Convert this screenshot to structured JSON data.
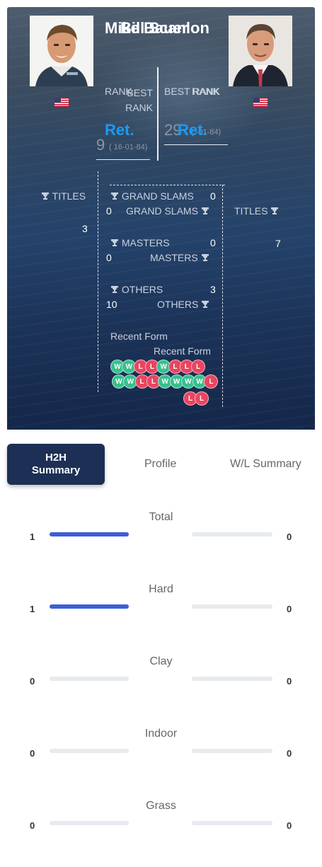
{
  "players": {
    "left": {
      "name": "Mike Bauer",
      "rank_label": "RANK",
      "rank_value": "Ret.",
      "best_rank_label": "BEST RANK",
      "best_rank_value": "9",
      "best_rank_date": "( 16-01-84)",
      "titles_label": "TITLES",
      "titles_value": "3",
      "grand_slams_label": "GRAND SLAMS",
      "grand_slams_value": "0",
      "masters_label": "MASTERS",
      "masters_value": "0",
      "others_label": "OTHERS",
      "others_value": "3",
      "recent_form_label": "Recent Form",
      "recent_form": [
        "W",
        "W",
        "L",
        "L",
        "W",
        "L",
        "L",
        "L"
      ]
    },
    "right": {
      "name": "Bill Scanlon",
      "rank_label": "RANK",
      "rank_value": "Ret.",
      "best_rank_label": "BEST RANK",
      "best_rank_value": "29",
      "best_rank_date": "( -01-84)",
      "titles_label": "TITLES",
      "titles_value": "7",
      "grand_slams_label": "GRAND SLAMS",
      "grand_slams_value": "0",
      "masters_label": "MASTERS",
      "masters_value": "0",
      "others_label": "OTHERS",
      "others_value": "10",
      "recent_form_label": "Recent Form",
      "recent_form": [
        "W",
        "W",
        "L",
        "L",
        "W",
        "W",
        "W",
        "W",
        "L",
        "L",
        "L"
      ]
    }
  },
  "tabs": {
    "h2h_line1": "H2H",
    "h2h_line2": "Summary",
    "profile": "Profile",
    "wl_summary": "W/L Summary"
  },
  "surfaces": [
    {
      "label": "Total",
      "left": "1",
      "right": "0",
      "left_fraction": 1.0,
      "right_fraction": 0.0
    },
    {
      "label": "Hard",
      "left": "1",
      "right": "0",
      "left_fraction": 1.0,
      "right_fraction": 0.0
    },
    {
      "label": "Clay",
      "left": "0",
      "right": "0",
      "left_fraction": 0.0,
      "right_fraction": 0.0
    },
    {
      "label": "Indoor",
      "left": "0",
      "right": "0",
      "left_fraction": 0.0,
      "right_fraction": 0.0
    },
    {
      "label": "Grass",
      "left": "0",
      "right": "0",
      "left_fraction": 0.0,
      "right_fraction": 0.0
    }
  ],
  "colors": {
    "accent_blue": "#1a9bf5",
    "bar_fill": "#3c5fd6",
    "tab_active": "#1d2f55",
    "win": "#37c08e",
    "loss": "#e94560"
  },
  "icons": [
    "trophy-icon",
    "us-flag-icon"
  ]
}
